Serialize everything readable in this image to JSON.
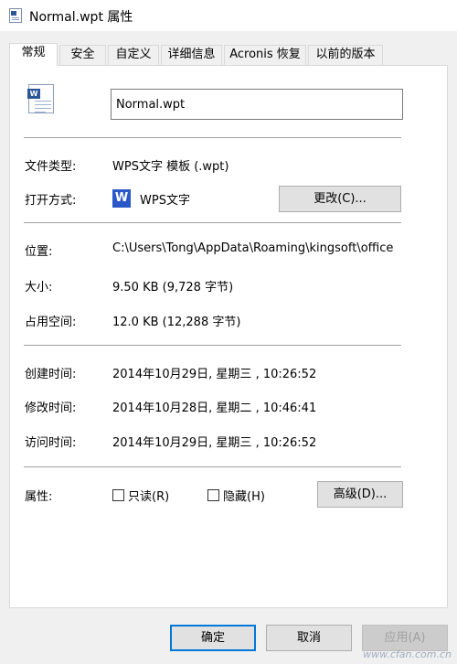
{
  "window": {
    "title": "Normal.wpt 属性"
  },
  "tabs": [
    {
      "label": "常规",
      "active": true
    },
    {
      "label": "安全"
    },
    {
      "label": "自定义"
    },
    {
      "label": "详细信息"
    },
    {
      "label": "Acronis 恢复"
    },
    {
      "label": "以前的版本"
    }
  ],
  "file": {
    "name": "Normal.wpt",
    "icon": "wps-document-icon"
  },
  "details": {
    "type_label": "文件类型:",
    "type_value": "WPS文字 模板 (.wpt)",
    "open_label": "打开方式:",
    "open_app": "WPS文字",
    "open_app_icon_char": "W",
    "change_button": "更改(C)...",
    "location_label": "位置:",
    "location_value": "C:\\Users\\Tong\\AppData\\Roaming\\kingsoft\\office",
    "size_label": "大小:",
    "size_value": "9.50 KB (9,728 字节)",
    "disk_label": "占用空间:",
    "disk_value": "12.0 KB (12,288 字节)",
    "created_label": "创建时间:",
    "created_value": "2014年10月29日, 星期三 , 10:26:52",
    "modified_label": "修改时间:",
    "modified_value": "2014年10月28日, 星期二 , 10:46:41",
    "accessed_label": "访问时间:",
    "accessed_value": "2014年10月29日, 星期三 , 10:26:52"
  },
  "attributes": {
    "label": "属性:",
    "readonly": {
      "label": "只读(R)",
      "checked": false
    },
    "hidden": {
      "label": "隐藏(H)",
      "checked": false
    },
    "advanced_button": "高级(D)..."
  },
  "footer": {
    "ok": "确定",
    "cancel": "取消",
    "apply": "应用(A)"
  },
  "watermark": "www.cfan.com.cn",
  "colors": {
    "accent": "#0078d7",
    "wps_blue": "#2b58c9",
    "word_blue": "#2b579a"
  }
}
